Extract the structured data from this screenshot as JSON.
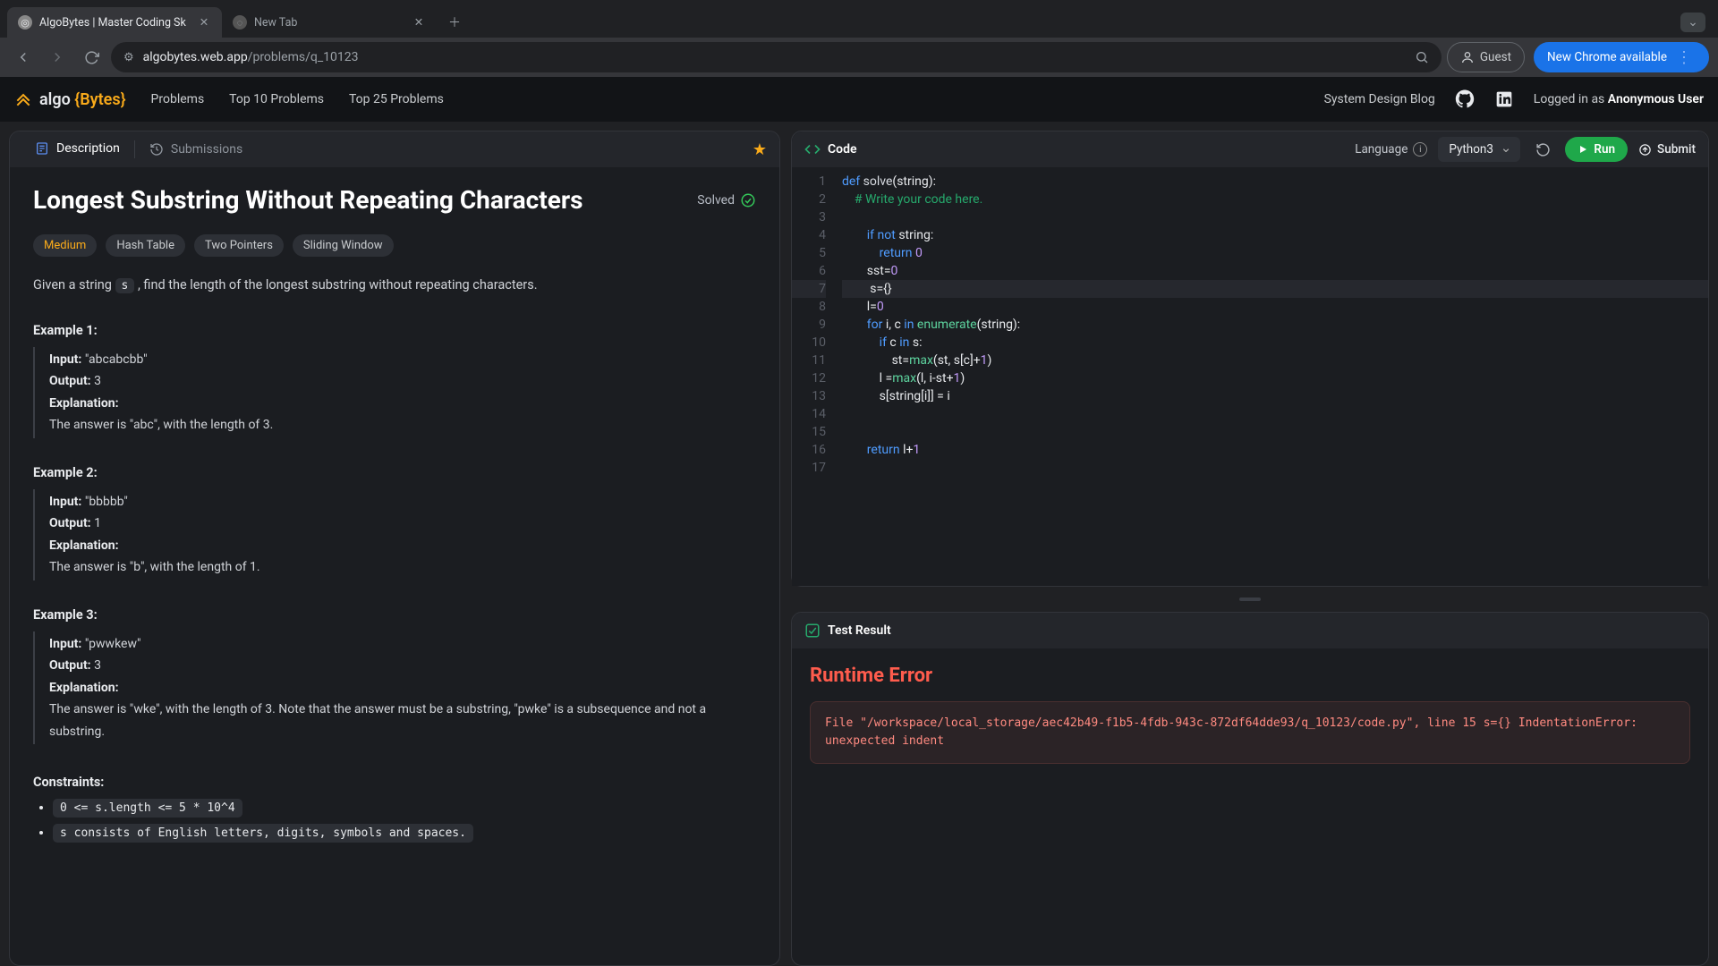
{
  "browser": {
    "tabs": [
      {
        "title": "AlgoBytes | Master Coding Sk",
        "active": true
      },
      {
        "title": "New Tab",
        "active": false
      }
    ],
    "url_host": "algobytes.web.app",
    "url_path": "/problems/q_10123",
    "guest_label": "Guest",
    "update_label": "New Chrome available"
  },
  "header": {
    "brand1": "algo ",
    "brand2": "{Bytes}",
    "links": [
      "Problems",
      "Top 10 Problems",
      "Top 25 Problems"
    ],
    "sys_design": "System Design Blog",
    "login_prefix": "Logged in as ",
    "login_user": "Anonymous User"
  },
  "left": {
    "tab_desc": "Description",
    "tab_subm": "Submissions",
    "title": "Longest Substring Without Repeating Characters",
    "solved": "Solved",
    "difficulty": "Medium",
    "tags": [
      "Hash Table",
      "Two Pointers",
      "Sliding Window"
    ],
    "prompt_pre": "Given a string ",
    "prompt_code": "s",
    "prompt_post": " , find the length of the longest substring without repeating characters.",
    "examples": [
      {
        "heading": "Example 1:",
        "input": "\"abcabcbb\"",
        "output": "3",
        "explanation": "The answer is \"abc\", with the length of 3."
      },
      {
        "heading": "Example 2:",
        "input": "\"bbbbb\"",
        "output": "1",
        "explanation": "The answer is \"b\", with the length of 1."
      },
      {
        "heading": "Example 3:",
        "input": "\"pwwkew\"",
        "output": "3",
        "explanation": "The answer is \"wke\", with the length of 3. Note that the answer must be a substring, \"pwke\" is a subsequence and not a substring."
      }
    ],
    "labels": {
      "input": "Input:  ",
      "output": "Output: ",
      "explanation": "Explanation:"
    },
    "constraints_heading": "Constraints:",
    "constraints": [
      "0 <= s.length <= 5 * 10^4",
      "s consists of English letters, digits, symbols and spaces."
    ]
  },
  "code": {
    "header": "Code",
    "lang_label": "Language",
    "lang_value": "Python3",
    "run": "Run",
    "submit": "Submit",
    "lines_count": 17,
    "highlight_line": 7
  },
  "result": {
    "header": "Test Result",
    "error_title": "Runtime Error",
    "error_text": "File \"/workspace/local_storage/aec42b49-f1b5-4fdb-943c-872df64dde93/q_10123/code.py\", line 15 s={} IndentationError: unexpected indent"
  }
}
